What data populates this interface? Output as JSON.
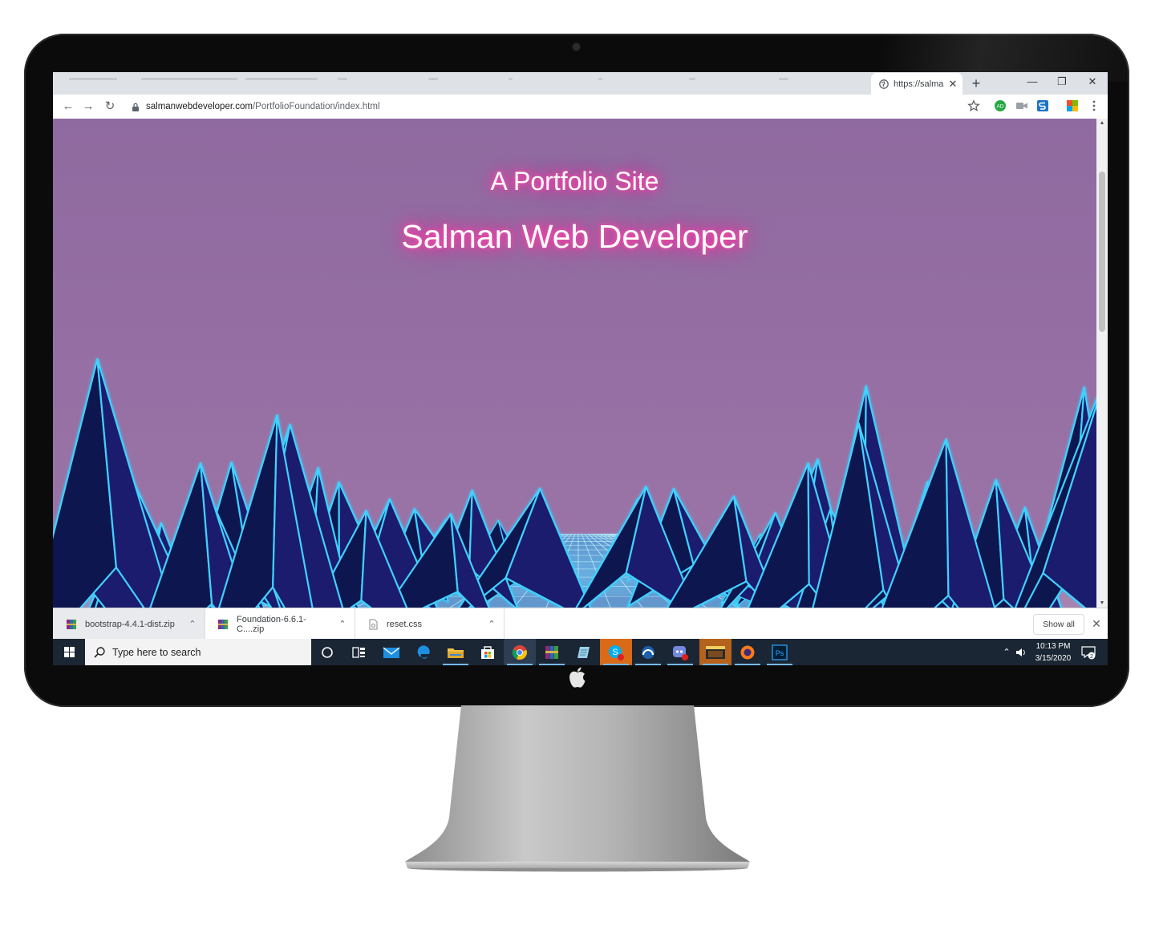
{
  "browser": {
    "tab_title": "https://salma",
    "tab_close": "✕",
    "new_tab": "+",
    "window_controls": {
      "minimize": "—",
      "restore": "❐",
      "close": "✕"
    },
    "url_host": "salmanwebdeveloper.com",
    "url_path": "/PortfolioFoundation/index.html",
    "extension_badge": "AD"
  },
  "page": {
    "subtitle": "A Portfolio Site",
    "title": "Salman Web Developer",
    "colors": {
      "background": "#8f6aa0",
      "neon_lines": "#3fd1ff",
      "glow": "#ff2e9f"
    }
  },
  "downloads": {
    "items": [
      {
        "name": "bootstrap-4.4.1-dist.zip",
        "icon": "winrar-archive-icon"
      },
      {
        "name": "Foundation-6.6.1-C....zip",
        "icon": "winrar-archive-icon"
      },
      {
        "name": "reset.css",
        "icon": "css-file-icon"
      }
    ],
    "show_all": "Show all",
    "close": "✕"
  },
  "taskbar": {
    "search_placeholder": "Type here to search",
    "apps": [
      "cortana-icon",
      "task-view-icon",
      "mail-icon",
      "edge-icon",
      "file-explorer-icon",
      "store-icon",
      "chrome-icon",
      "winrar-icon",
      "notepad-icon",
      "skype-icon",
      "app-icon",
      "discord-icon",
      "media-player-icon",
      "firefox-icon",
      "photoshop-icon"
    ],
    "time": "10:13 PM",
    "date": "3/15/2020",
    "notifications": "2"
  }
}
